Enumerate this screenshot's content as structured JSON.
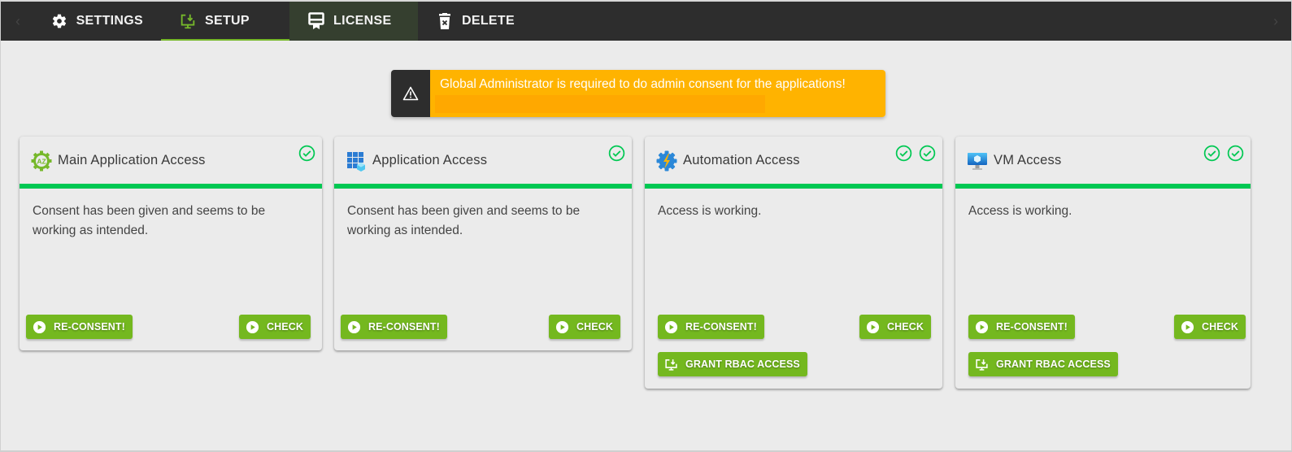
{
  "nav": {
    "prev_arrow": "‹",
    "next_arrow": "›",
    "tabs": [
      {
        "label": "SETTINGS",
        "icon": "gear-icon"
      },
      {
        "label": "SETUP",
        "icon": "install-icon",
        "active": true
      },
      {
        "label": "LICENSE",
        "icon": "certificate-icon"
      },
      {
        "label": "DELETE",
        "icon": "trash-icon"
      }
    ]
  },
  "alert": {
    "icon": "warning-icon",
    "message": "Global Administrator is required to do admin consent for the applications!",
    "colors": {
      "background": "#ffb300",
      "icon_box": "#2d2d2d"
    }
  },
  "colors": {
    "accent_green": "#76b82a",
    "status_bar": "#00c853",
    "button": "#74b81f"
  },
  "cards": [
    {
      "title": "Main Application Access",
      "icon": "az-gear-icon",
      "checks": 1,
      "text": "Consent has been given and seems to be working as intended.",
      "buttons": {
        "reconsent": "RE-CONSENT!",
        "check": "CHECK"
      }
    },
    {
      "title": "Application Access",
      "icon": "app-grid-icon",
      "checks": 1,
      "text": "Consent has been given and seems to be working as intended.",
      "buttons": {
        "reconsent": "RE-CONSENT!",
        "check": "CHECK"
      }
    },
    {
      "title": "Automation Access",
      "icon": "automation-gear-icon",
      "checks": 2,
      "text": "Access is working.",
      "buttons": {
        "reconsent": "RE-CONSENT!",
        "check": "CHECK",
        "rbac": "GRANT RBAC ACCESS"
      }
    },
    {
      "title": "VM Access",
      "icon": "vm-monitor-icon",
      "checks": 2,
      "text": "Access is working.",
      "buttons": {
        "reconsent": "RE-CONSENT!",
        "check": "CHECK",
        "rbac": "GRANT RBAC ACCESS"
      }
    }
  ]
}
